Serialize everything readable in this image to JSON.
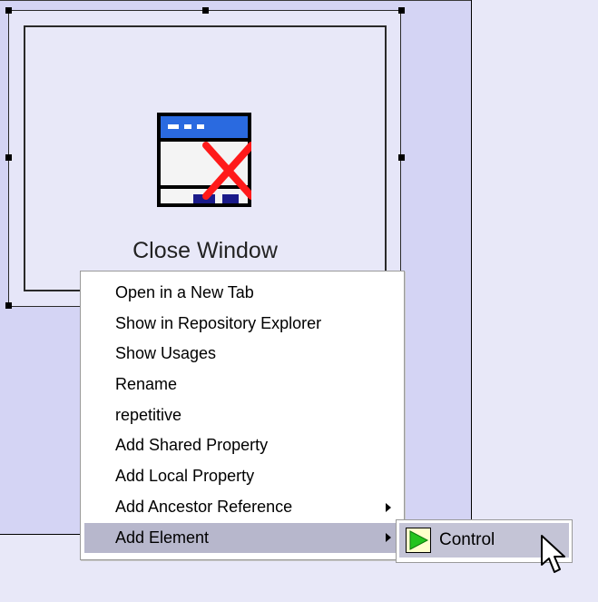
{
  "canvas": {
    "element": {
      "label": "Close Window",
      "icon": "close-window-icon"
    }
  },
  "context_menu": {
    "items": [
      {
        "label": "Open in a New Tab",
        "has_submenu": false
      },
      {
        "label": "Show in Repository Explorer",
        "has_submenu": false
      },
      {
        "label": "Show Usages",
        "has_submenu": false
      },
      {
        "label": "Rename",
        "has_submenu": false
      },
      {
        "label": "repetitive",
        "has_submenu": false
      },
      {
        "label": "Add Shared Property",
        "has_submenu": false
      },
      {
        "label": "Add Local Property",
        "has_submenu": false
      },
      {
        "label": "Add Ancestor Reference",
        "has_submenu": true
      },
      {
        "label": "Add Element",
        "has_submenu": true,
        "highlighted": true
      }
    ]
  },
  "submenu": {
    "items": [
      {
        "label": "Control",
        "icon": "play-triangle-icon",
        "highlighted": true
      }
    ]
  },
  "colors": {
    "canvas_bg": "#d4d4f4",
    "page_bg": "#e8e8f8",
    "menu_highlight": "#b7b7cc",
    "submenu_highlight": "#c4c4d6",
    "icon_blue": "#2a6ae0",
    "icon_red": "#ff1a1a",
    "icon_green": "#23c41e"
  }
}
